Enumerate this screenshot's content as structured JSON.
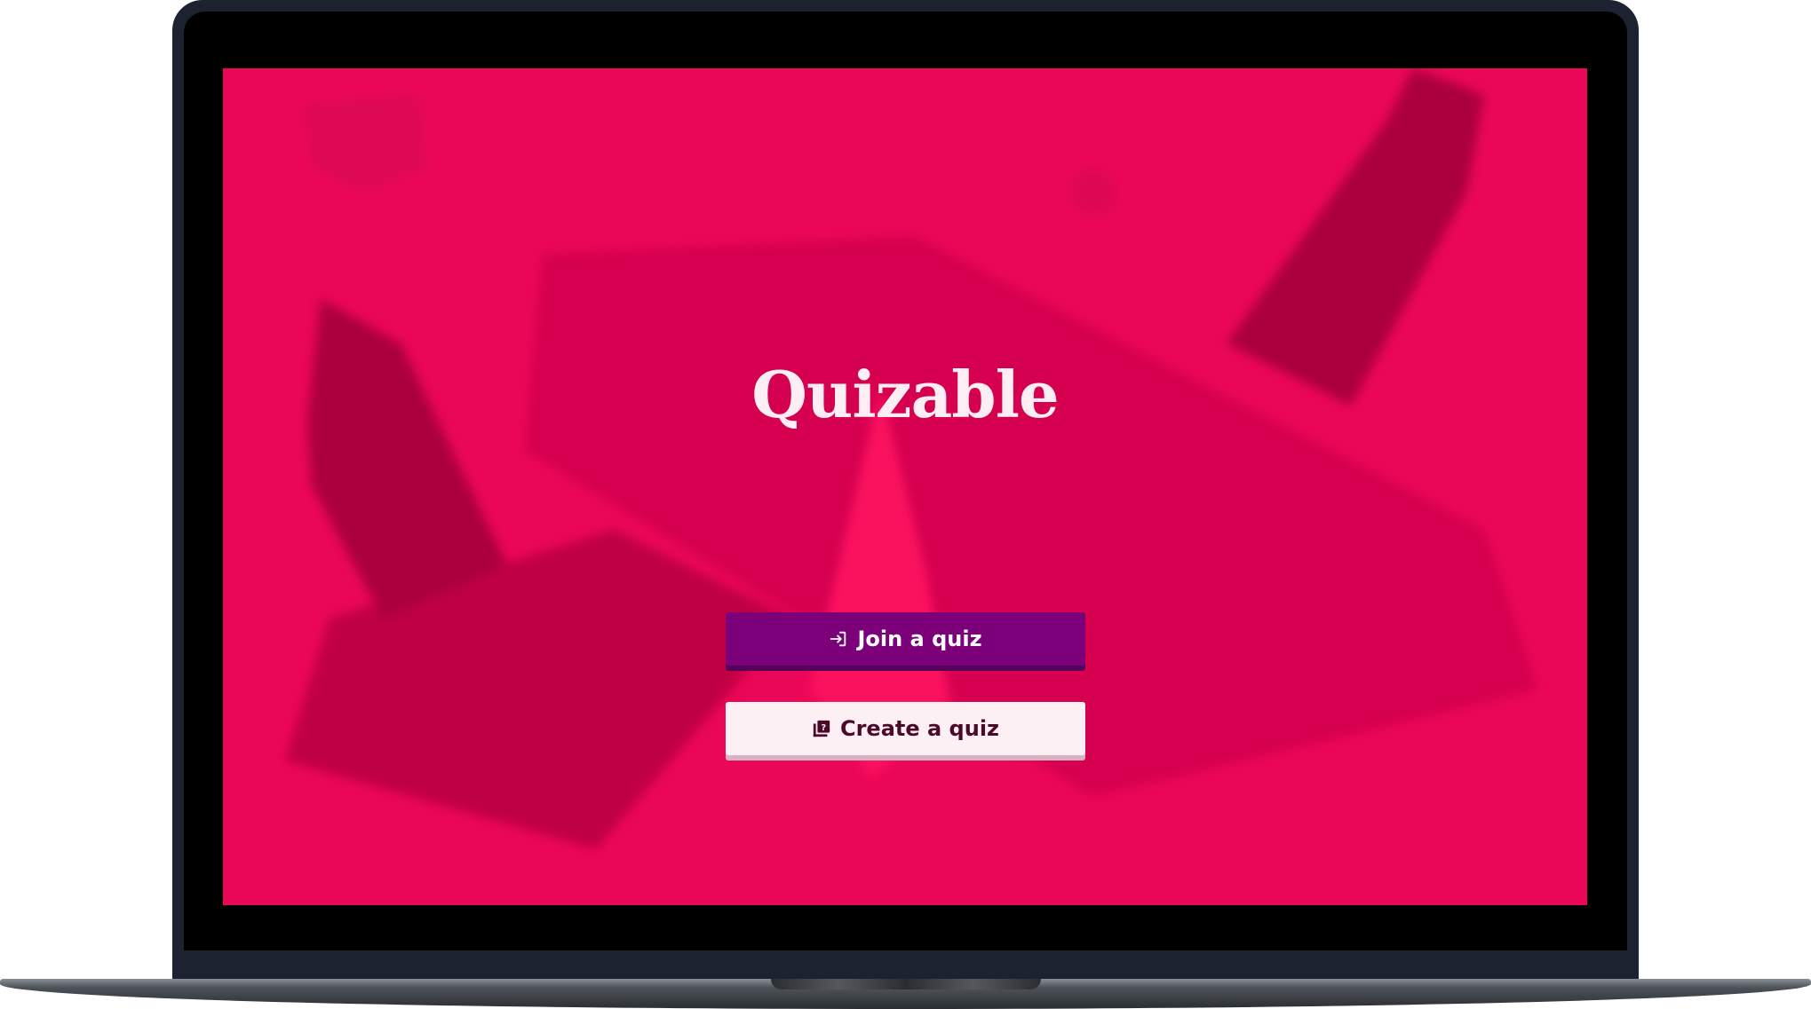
{
  "app": {
    "title": "Quizable"
  },
  "actions": {
    "join_label": "Join a quiz",
    "create_label": "Create a quiz"
  },
  "icons": {
    "join": "sign-in-icon",
    "create": "quiz-book-icon"
  },
  "colors": {
    "background": "#eb0757",
    "join_button": "#7b007a",
    "create_button": "#fdf0f4",
    "logo_text": "#fdeef3"
  }
}
